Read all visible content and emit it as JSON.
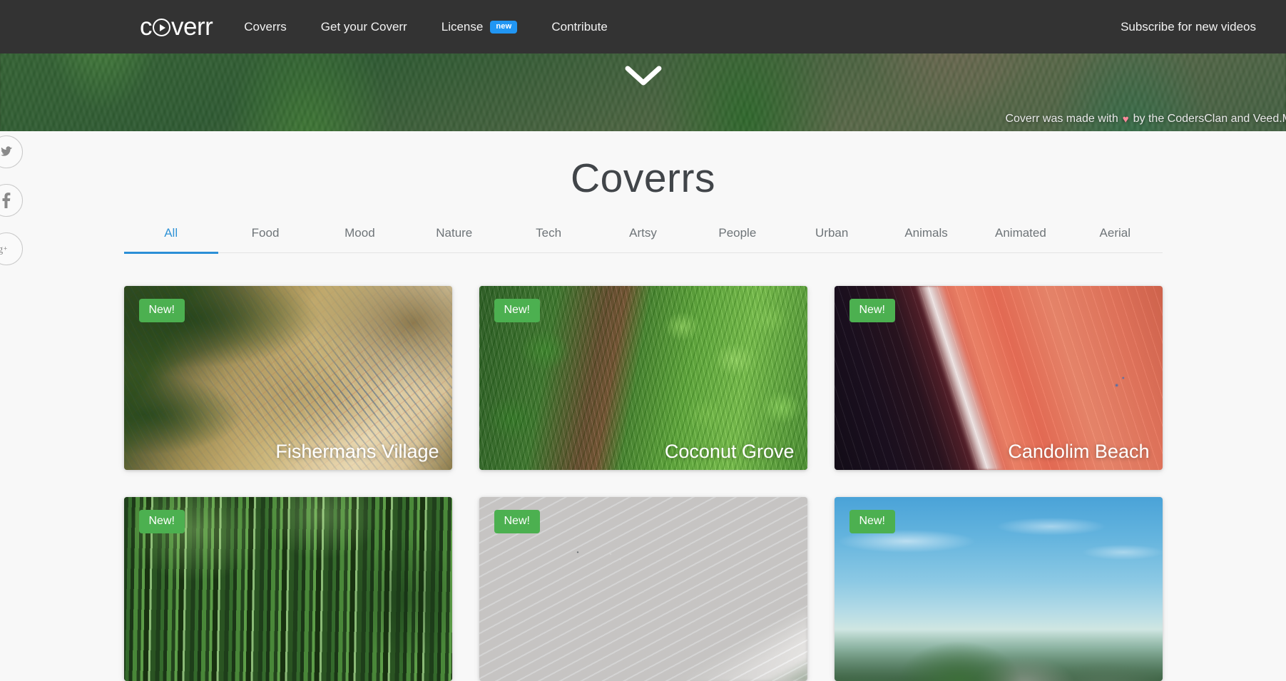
{
  "header": {
    "logo_text_before": "c",
    "logo_icon": "play-circle-icon",
    "logo_text_after": "verr",
    "nav": [
      {
        "label": "Coverrs",
        "badge": null
      },
      {
        "label": "Get your Coverr",
        "badge": null
      },
      {
        "label": "License",
        "badge": "new"
      },
      {
        "label": "Contribute",
        "badge": null
      }
    ],
    "subscribe_label": "Subscribe for new videos",
    "background_color": "#333333"
  },
  "hero": {
    "scroll_icon": "chevron-down-icon",
    "credit_before": "Coverr was made with",
    "credit_heart": "♥",
    "credit_after": "by the CodersClan and Veed.M",
    "heart_color": "#ff8a9c"
  },
  "social_rail": [
    {
      "name": "twitter",
      "glyph": "twitter-icon"
    },
    {
      "name": "facebook",
      "glyph": "facebook-icon"
    },
    {
      "name": "google-plus",
      "glyph": "google-plus-icon"
    }
  ],
  "main": {
    "page_title": "Coverrs",
    "accent_color": "#2b8fd6",
    "tabs": [
      {
        "label": "All",
        "active": true
      },
      {
        "label": "Food",
        "active": false
      },
      {
        "label": "Mood",
        "active": false
      },
      {
        "label": "Nature",
        "active": false
      },
      {
        "label": "Tech",
        "active": false
      },
      {
        "label": "Artsy",
        "active": false
      },
      {
        "label": "People",
        "active": false
      },
      {
        "label": "Urban",
        "active": false
      },
      {
        "label": "Animals",
        "active": false
      },
      {
        "label": "Animated",
        "active": false
      },
      {
        "label": "Aerial",
        "active": false
      }
    ],
    "badge_label": "New!",
    "badge_color": "#4cb050",
    "cards": [
      {
        "title": "Fishermans Village",
        "badge": "New!",
        "art": "art-village"
      },
      {
        "title": "Coconut Grove",
        "badge": "New!",
        "art": "art-grove"
      },
      {
        "title": "Candolim Beach",
        "badge": "New!",
        "art": "art-candolim"
      },
      {
        "title": "",
        "badge": "New!",
        "art": "art-trunks"
      },
      {
        "title": "",
        "badge": "New!",
        "art": "art-sand"
      },
      {
        "title": "",
        "badge": "New!",
        "art": "art-mountain"
      }
    ]
  }
}
